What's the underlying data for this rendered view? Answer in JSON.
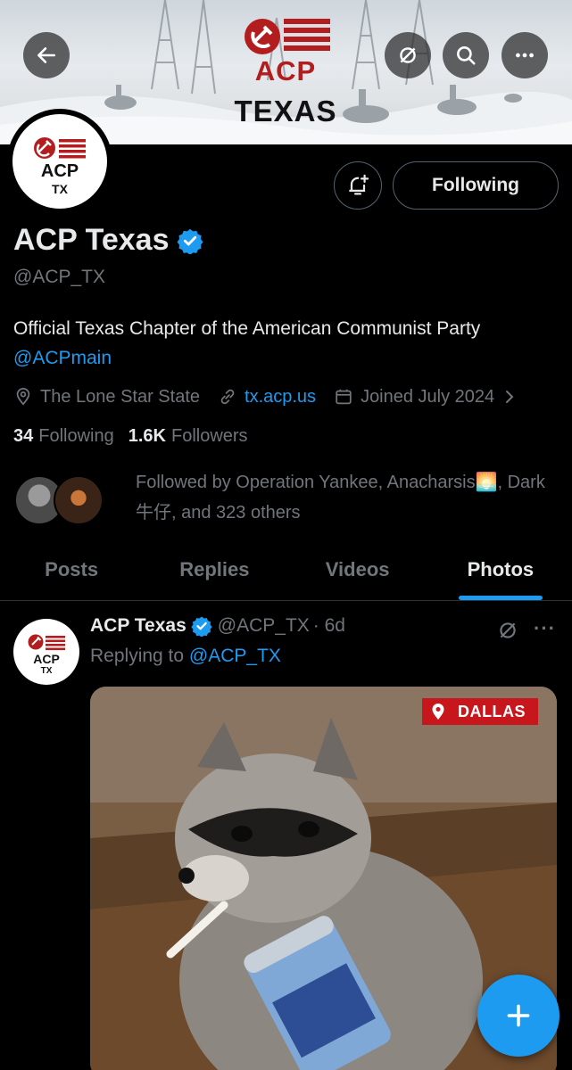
{
  "banner": {
    "logo_text": "ACP",
    "state_text": "TEXAS"
  },
  "header": {
    "back_icon": "arrow-left-icon",
    "grok_icon": "grok-icon",
    "search_icon": "search-icon",
    "more_icon": "more-horizontal-icon"
  },
  "profile": {
    "avatar_acp": "ACP",
    "avatar_tx": "TX",
    "name": "ACP Texas",
    "handle": "@ACP_TX",
    "bio_text": "Official Texas Chapter of the American Communist Party ",
    "bio_mention": "@ACPmain",
    "location": "The Lone Star State",
    "website": "tx.acp.us",
    "joined": "Joined July 2024",
    "following_count": "34",
    "following_label": "Following",
    "followers_count": "1.6K",
    "followers_label": "Followers",
    "followed_by": "Followed by Operation Yankee, Anacharsis🌅, Dark 牛仔, and 323 others",
    "follow_button": "Following"
  },
  "tabs": [
    "Posts",
    "Replies",
    "Videos",
    "Photos"
  ],
  "active_tab": "Photos",
  "tweet": {
    "name": "ACP Texas",
    "handle": "@ACP_TX",
    "time": "· 6d",
    "replying_prefix": "Replying to ",
    "replying_to": "@ACP_TX",
    "media_tag": "DALLAS",
    "more": "···"
  },
  "colors": {
    "accent": "#1d9bf0",
    "brand_red": "#b41d1d",
    "verified": "#1d9bf0"
  }
}
